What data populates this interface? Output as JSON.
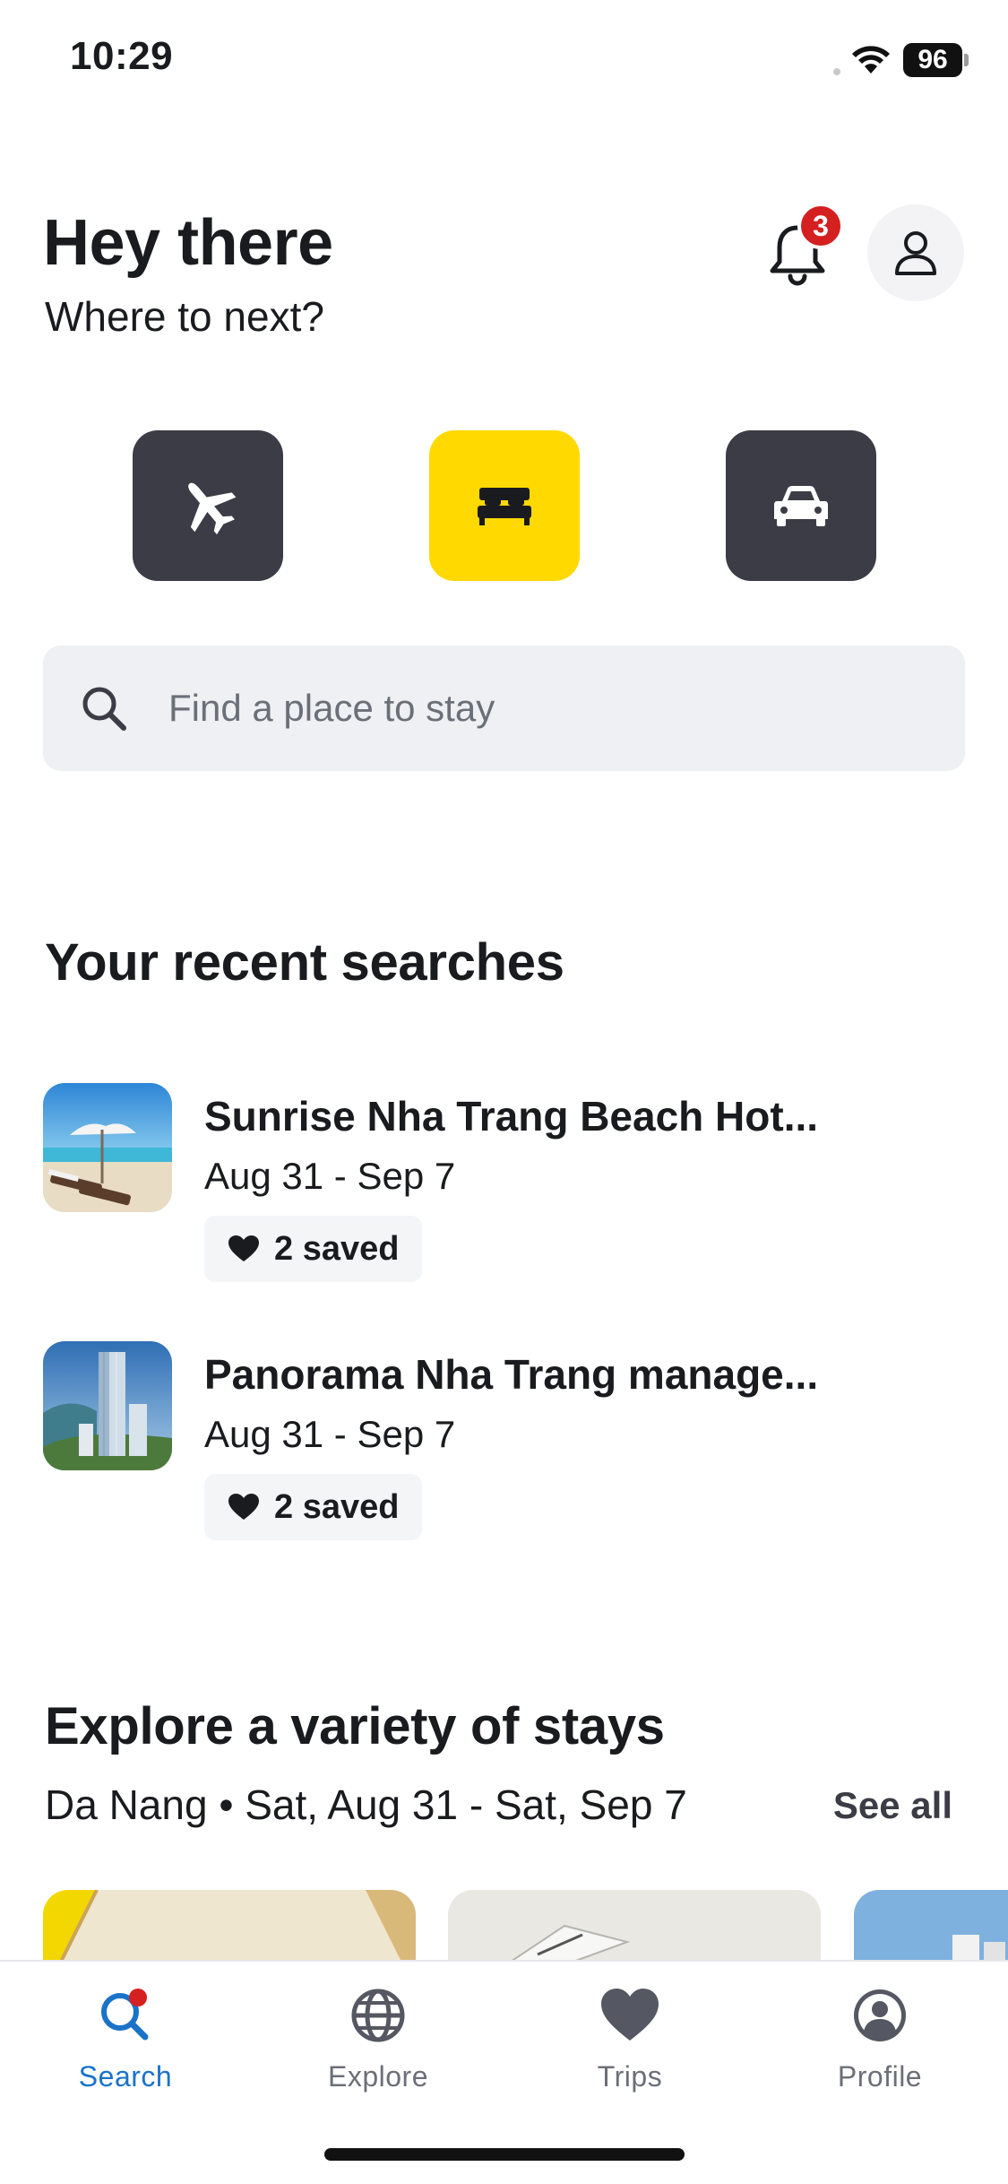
{
  "status_bar": {
    "time": "10:29",
    "battery": "96"
  },
  "header": {
    "greeting": "Hey there",
    "subtitle": "Where to next?",
    "notifications_count": "3",
    "icons": [
      "bell-icon",
      "user-icon"
    ]
  },
  "verticals": [
    {
      "name": "flights",
      "icon": "plane-icon",
      "selected": false
    },
    {
      "name": "stays",
      "icon": "bed-icon",
      "selected": true
    },
    {
      "name": "cars",
      "icon": "car-icon",
      "selected": false
    }
  ],
  "search": {
    "placeholder": "Find a place to stay"
  },
  "recent": {
    "title": "Your recent searches",
    "items": [
      {
        "name": "Sunrise Nha Trang Beach Hot...",
        "dates": "Aug 31 - Sep 7",
        "saved": "2 saved"
      },
      {
        "name": "Panorama Nha Trang manage...",
        "dates": "Aug 31 - Sep 7",
        "saved": "2 saved"
      }
    ]
  },
  "explore": {
    "title": "Explore a variety of stays",
    "subtitle": "Da Nang • Sat, Aug 31 - Sat, Sep 7",
    "see_all": "See all"
  },
  "tabs": [
    {
      "label": "Search",
      "icon": "search-icon",
      "active": true
    },
    {
      "label": "Explore",
      "icon": "globe-icon",
      "active": false
    },
    {
      "label": "Trips",
      "icon": "heart-icon",
      "active": false
    },
    {
      "label": "Profile",
      "icon": "profile-icon",
      "active": false
    }
  ],
  "colors": {
    "accent_yellow": "#ffd900",
    "tile_dark": "#3b3c45",
    "active_blue": "#1a73c9",
    "badge_red": "#d42020"
  }
}
